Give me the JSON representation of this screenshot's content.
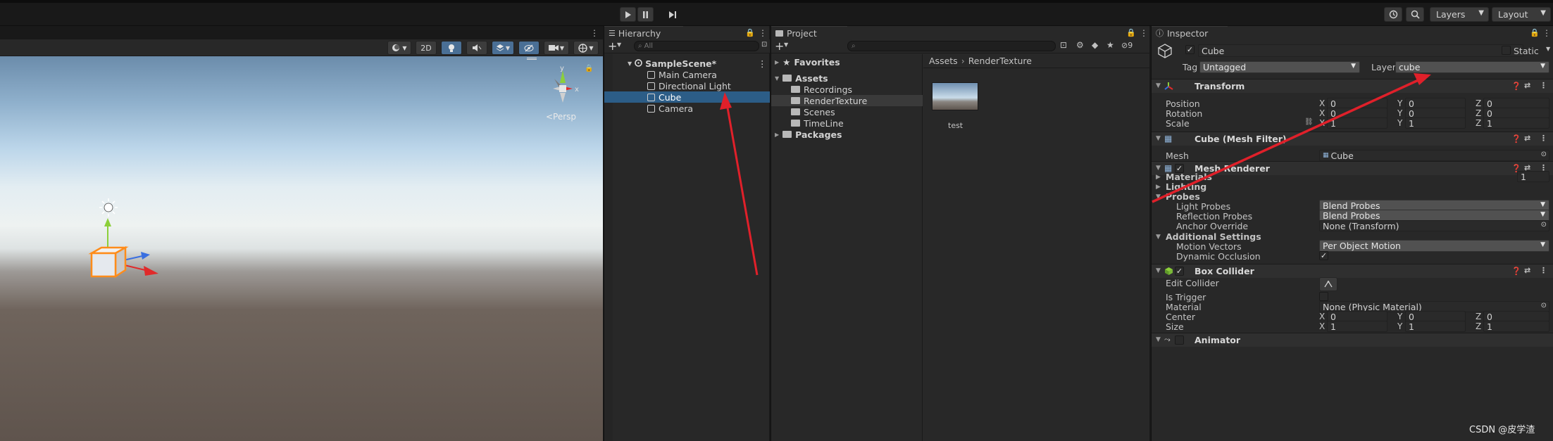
{
  "toolbar": {
    "play_icon": "play-icon",
    "pause_icon": "pause-icon",
    "step_icon": "step-icon",
    "layers_label": "Layers",
    "layout_label": "Layout"
  },
  "scene": {
    "tools_2d": "2D",
    "persp_label": "<Persp",
    "gizmo_y": "y",
    "gizmo_x": "x"
  },
  "hierarchy": {
    "tab_label": "Hierarchy",
    "search_placeholder": "All",
    "scene_name": "SampleScene*",
    "items": [
      {
        "label": "Main Camera"
      },
      {
        "label": "Directional Light"
      },
      {
        "label": "Cube"
      },
      {
        "label": "Camera"
      }
    ]
  },
  "project": {
    "tab_label": "Project",
    "badge_count": "9",
    "favorites": "Favorites",
    "assets": "Assets",
    "folders": [
      "Recordings",
      "RenderTexture",
      "Scenes",
      "TimeLine"
    ],
    "packages": "Packages",
    "breadcrumb_root": "Assets",
    "breadcrumb_current": "RenderTexture",
    "asset_name": "test"
  },
  "inspector": {
    "tab_label": "Inspector",
    "object_name": "Cube",
    "static_label": "Static",
    "tag_label": "Tag",
    "tag_value": "Untagged",
    "layer_label": "Layer",
    "layer_value": "cube",
    "transform": {
      "title": "Transform",
      "position_label": "Position",
      "rotation_label": "Rotation",
      "scale_label": "Scale",
      "position": [
        "0",
        "0",
        "0"
      ],
      "rotation": [
        "0",
        "0",
        "0"
      ],
      "scale": [
        "1",
        "1",
        "1"
      ]
    },
    "mesh_filter": {
      "title": "Cube (Mesh Filter)",
      "mesh_label": "Mesh",
      "mesh_value": "Cube"
    },
    "mesh_renderer": {
      "title": "Mesh Renderer",
      "materials_label": "Materials",
      "materials_count": "1",
      "lighting_label": "Lighting",
      "probes_label": "Probes",
      "light_probes_label": "Light Probes",
      "light_probes_value": "Blend Probes",
      "reflection_probes_label": "Reflection Probes",
      "reflection_probes_value": "Blend Probes",
      "anchor_override_label": "Anchor Override",
      "anchor_override_value": "None (Transform)",
      "additional_settings_label": "Additional Settings",
      "motion_vectors_label": "Motion Vectors",
      "motion_vectors_value": "Per Object Motion",
      "dynamic_occlusion_label": "Dynamic Occlusion"
    },
    "box_collider": {
      "title": "Box Collider",
      "edit_collider_label": "Edit Collider",
      "is_trigger_label": "Is Trigger",
      "material_label": "Material",
      "material_value": "None (Physic Material)",
      "center_label": "Center",
      "size_label": "Size",
      "center": [
        "0",
        "0",
        "0"
      ],
      "size": [
        "1",
        "1",
        "1"
      ]
    },
    "animator_title": "Animator"
  },
  "axis_labels": [
    "X",
    "Y",
    "Z"
  ],
  "watermark": "CSDN @皮学渣",
  "colors": {
    "selection": "#2c5d87",
    "annotation_arrow": "#e0202a",
    "panel_bg": "#282828"
  }
}
